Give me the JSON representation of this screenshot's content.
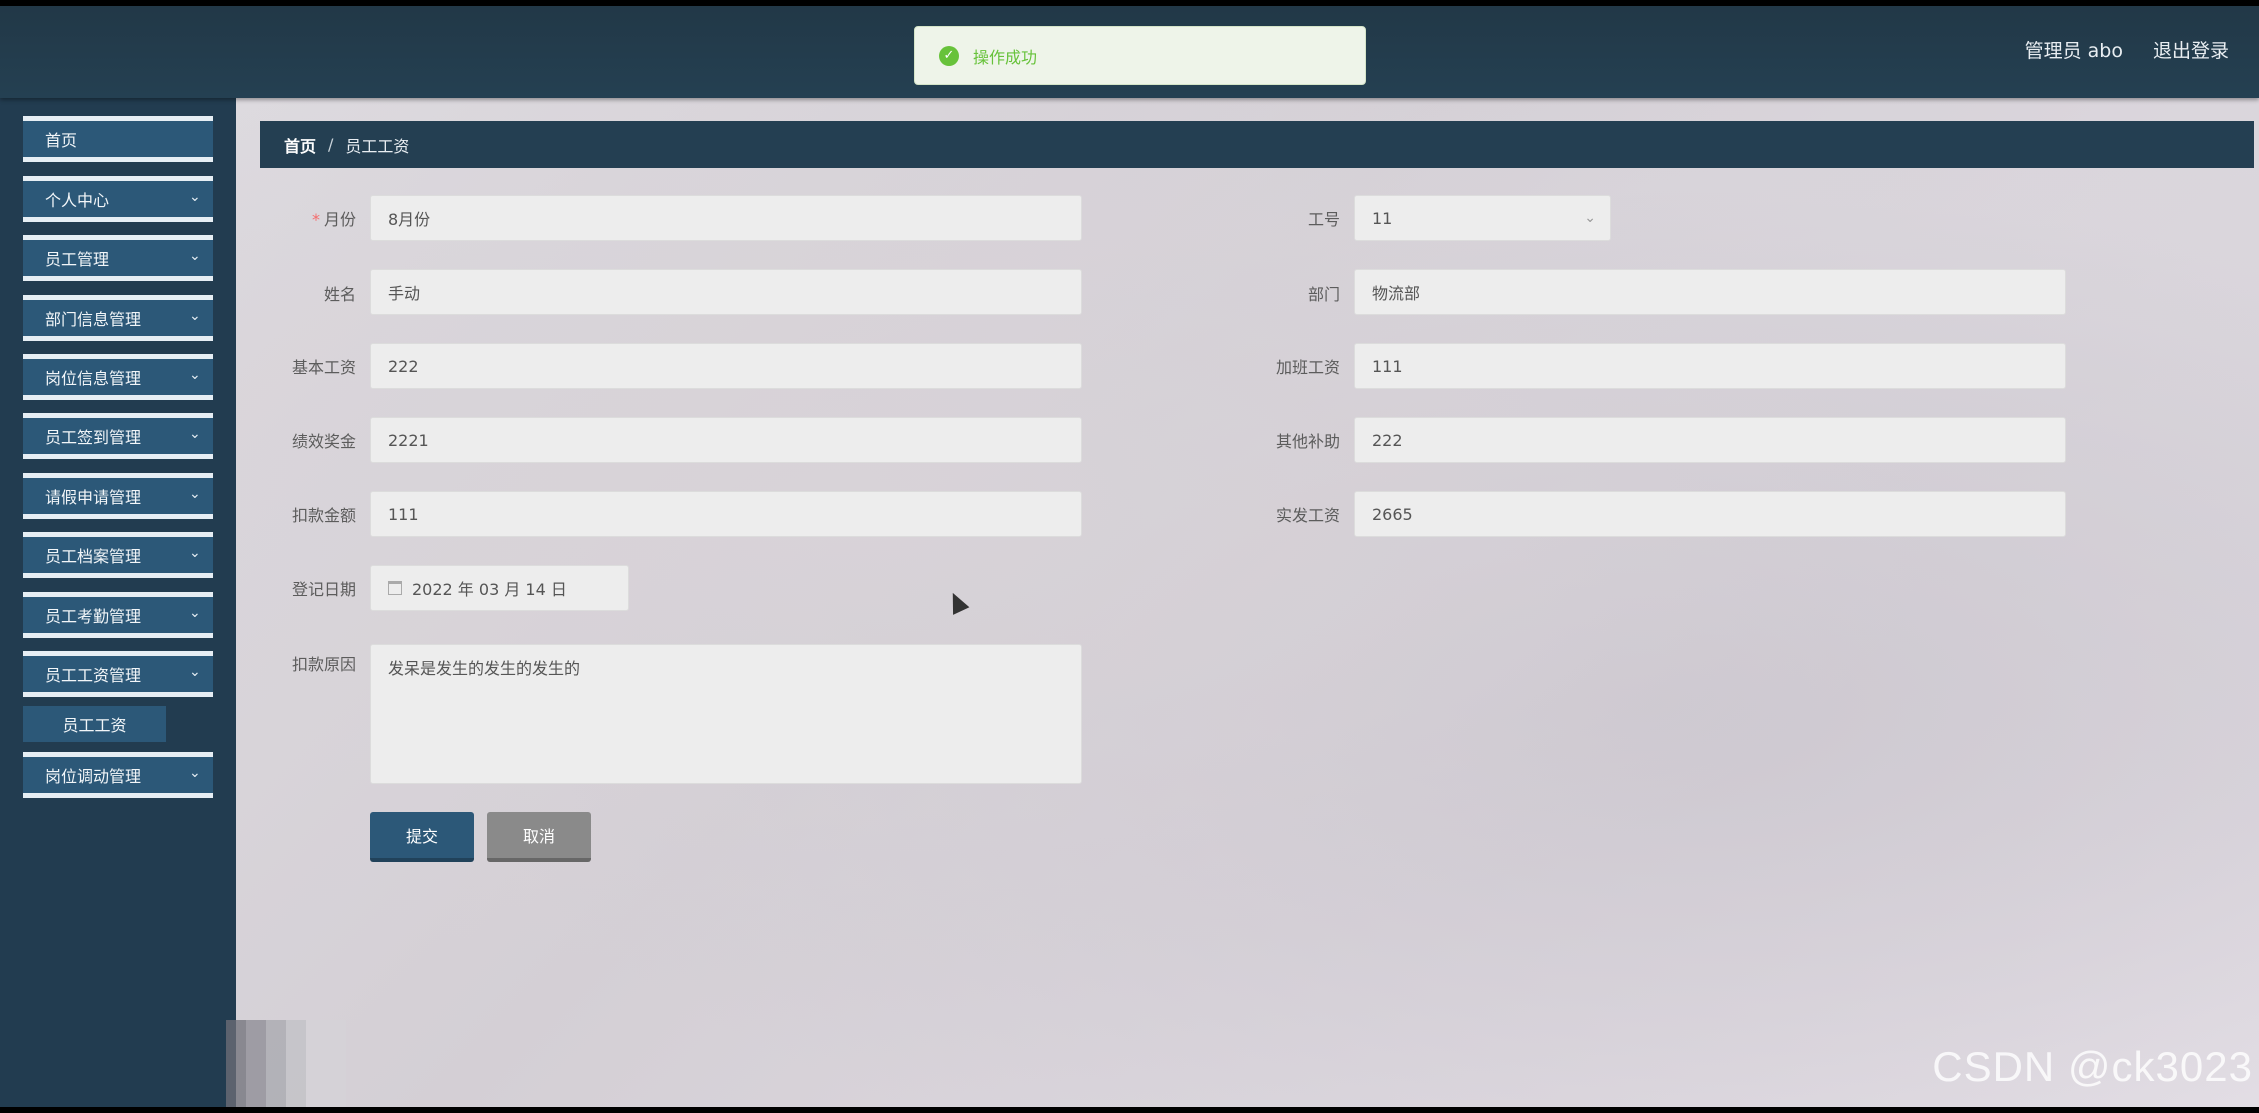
{
  "header": {
    "user_label": "管理员 abo",
    "logout_label": "退出登录"
  },
  "toast": {
    "message": "操作成功",
    "icon": "check-circle-icon",
    "color": "#67c23a"
  },
  "sidebar": {
    "items": [
      {
        "label": "首页",
        "has_children": false
      },
      {
        "label": "个人中心",
        "has_children": true
      },
      {
        "label": "员工管理",
        "has_children": true
      },
      {
        "label": "部门信息管理",
        "has_children": true
      },
      {
        "label": "岗位信息管理",
        "has_children": true
      },
      {
        "label": "员工签到管理",
        "has_children": true
      },
      {
        "label": "请假申请管理",
        "has_children": true
      },
      {
        "label": "员工档案管理",
        "has_children": true
      },
      {
        "label": "员工考勤管理",
        "has_children": true
      },
      {
        "label": "员工工资管理",
        "has_children": true
      },
      {
        "label": "岗位调动管理",
        "has_children": true
      }
    ],
    "sub_item": "员工工资"
  },
  "breadcrumb": {
    "home": "首页",
    "separator": "/",
    "current": "员工工资"
  },
  "form": {
    "month": {
      "label": "月份",
      "value": "8月份",
      "required": true
    },
    "emp_no": {
      "label": "工号",
      "value": "11"
    },
    "name": {
      "label": "姓名",
      "value": "手动"
    },
    "dept": {
      "label": "部门",
      "value": "物流部"
    },
    "base_salary": {
      "label": "基本工资",
      "value": "222"
    },
    "overtime": {
      "label": "加班工资",
      "value": "111"
    },
    "bonus": {
      "label": "绩效奖金",
      "value": "2221"
    },
    "allowance": {
      "label": "其他补助",
      "value": "222"
    },
    "deduction": {
      "label": "扣款金额",
      "value": "111"
    },
    "net_salary": {
      "label": "实发工资",
      "value": "2665"
    },
    "reg_date": {
      "label": "登记日期",
      "value": "2022 年 03 月 14 日"
    },
    "deduct_reason": {
      "label": "扣款原因",
      "value": "发呆是发生的发生的发生的"
    }
  },
  "buttons": {
    "submit": "提交",
    "cancel": "取消"
  },
  "watermark": "CSDN @ck3023",
  "colors": {
    "primary": "#2c5878",
    "topbar": "#223c50",
    "success": "#67c23a"
  }
}
